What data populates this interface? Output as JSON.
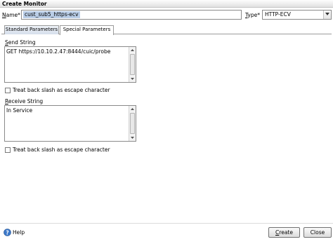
{
  "window": {
    "title": "Create Monitor"
  },
  "name_field": {
    "label_key": "N",
    "label_rest": "ame*",
    "value": "cust_sub5_https-ecv"
  },
  "type_field": {
    "label_key": "T",
    "label_rest": "ype*",
    "value": "HTTP-ECV"
  },
  "tabs": [
    {
      "label": "Standard Parameters"
    },
    {
      "label": "Special Parameters"
    }
  ],
  "send_string": {
    "label_key": "S",
    "label_rest": "end String",
    "value": "GET https://10.10.2.47:8444/cuic/probe"
  },
  "send_escape": {
    "label": "Treat back slash as escape character"
  },
  "receive_string": {
    "label_key": "R",
    "label_rest": "eceive String",
    "value": "In Service"
  },
  "receive_escape": {
    "label": "Treat back slash as escape character"
  },
  "footer": {
    "help_label": "Help",
    "create_key": "C",
    "create_rest": "reate",
    "close_label": "Close"
  }
}
